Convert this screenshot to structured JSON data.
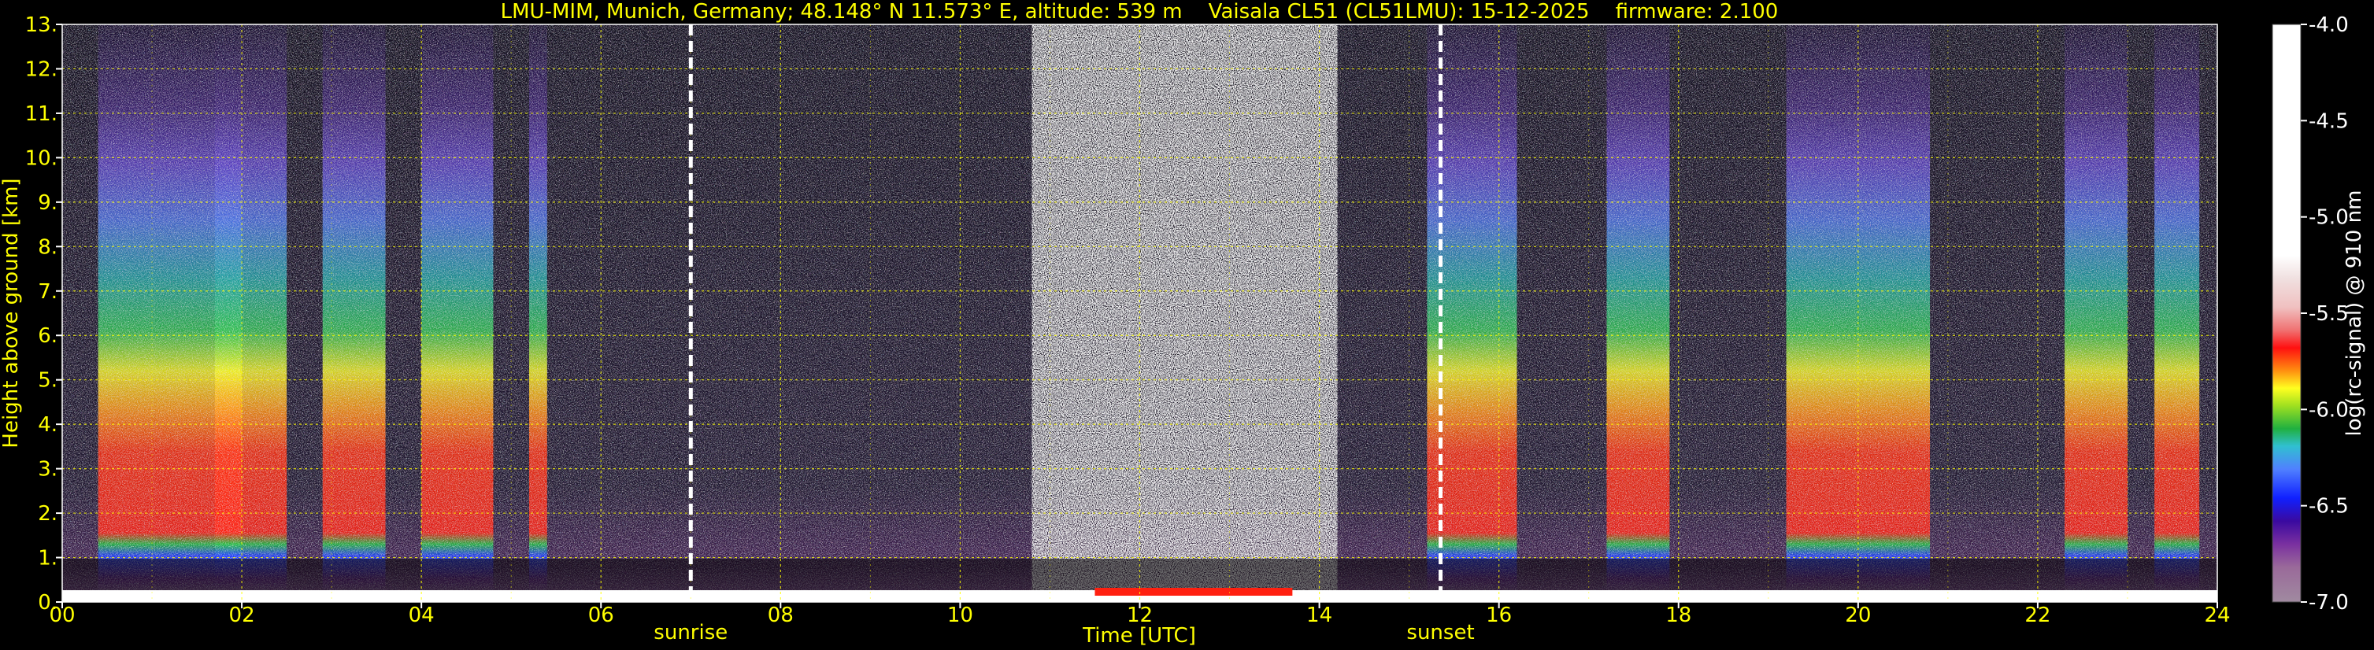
{
  "chart_data": {
    "type": "heatmap",
    "title": "LMU-MIM, Munich, Germany; 48.148° N 11.573° E, altitude: 539 m    Vaisala CL51 (CL51LMU): 15-12-2025    firmware: 2.100",
    "xlabel": "Time [UTC]",
    "ylabel": "Height above ground [km]",
    "colorbar_label": "log(rc-signal) @ 910 nm",
    "xlim": [
      0,
      24
    ],
    "ylim": [
      0,
      13
    ],
    "x_ticks": [
      "00",
      "02",
      "04",
      "06",
      "08",
      "10",
      "12",
      "14",
      "16",
      "18",
      "20",
      "22",
      "24"
    ],
    "x_tick_values": [
      0,
      2,
      4,
      6,
      8,
      10,
      12,
      14,
      16,
      18,
      20,
      22,
      24
    ],
    "y_ticks": [
      "0.",
      "1.",
      "2.",
      "3.",
      "4.",
      "5.",
      "6.",
      "7.",
      "8.",
      "9.",
      "10.",
      "11.",
      "12.",
      "13."
    ],
    "y_tick_values": [
      0,
      1,
      2,
      3,
      4,
      5,
      6,
      7,
      8,
      9,
      10,
      11,
      12,
      13
    ],
    "colorbar_ticks": [
      "-4.0",
      "-4.5",
      "-5.0",
      "-5.5",
      "-6.0",
      "-6.5",
      "-7.0"
    ],
    "colorbar_values": [
      -4.0,
      -4.5,
      -5.0,
      -5.5,
      -6.0,
      -6.5,
      -7.0
    ],
    "colorbar_range": [
      -7.0,
      -4.0
    ],
    "grid": true,
    "grid_color": "#ffff00",
    "text_color": "#ffff00",
    "background": "#000000",
    "annotations": [
      {
        "label": "sunrise",
        "time": 7.0
      },
      {
        "label": "sunset",
        "time": 15.35
      }
    ],
    "signal_bursts_hours": [
      [
        0.4,
        2.0
      ],
      [
        1.7,
        2.5
      ],
      [
        2.9,
        3.6
      ],
      [
        4.0,
        4.8
      ],
      [
        5.2,
        5.4
      ],
      [
        15.2,
        16.2
      ],
      [
        17.2,
        17.9
      ],
      [
        19.2,
        20.8
      ],
      [
        22.3,
        23.0
      ],
      [
        23.3,
        23.8
      ]
    ],
    "noisy_period_hours": [
      10.8,
      14.2
    ]
  }
}
